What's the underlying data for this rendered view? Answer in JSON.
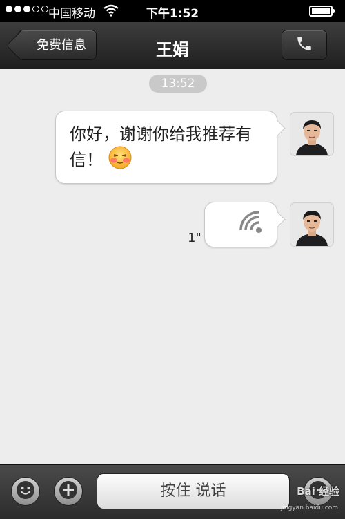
{
  "status_bar": {
    "carrier": "中国移动",
    "time": "下午1:52",
    "signal_bars": 3,
    "signal_total": 5,
    "wifi_icon": "wifi-icon",
    "battery_icon": "battery-icon"
  },
  "nav": {
    "back_label": "免费信息",
    "title": "王娟",
    "call_icon": "phone-icon"
  },
  "chat": {
    "timestamp": "13:52",
    "messages": [
      {
        "type": "text",
        "text": "你好，谢谢你给我推荐有信！",
        "emoji": "blushing-face-emoji"
      },
      {
        "type": "voice",
        "duration": "1\"",
        "icon": "voice-wave-icon"
      }
    ]
  },
  "toolbar": {
    "emoji_icon": "smiley-icon",
    "add_icon": "plus-icon",
    "talk_label": "按住 说话"
  },
  "watermark": {
    "text": "Bai 经验",
    "url": "jingyan.baidu.com"
  },
  "colors": {
    "nav_bg": "#2c2c2c",
    "chat_bg": "#ededed",
    "bubble_bg": "#ffffff",
    "timestamp_bg": "#c9c9c9"
  }
}
